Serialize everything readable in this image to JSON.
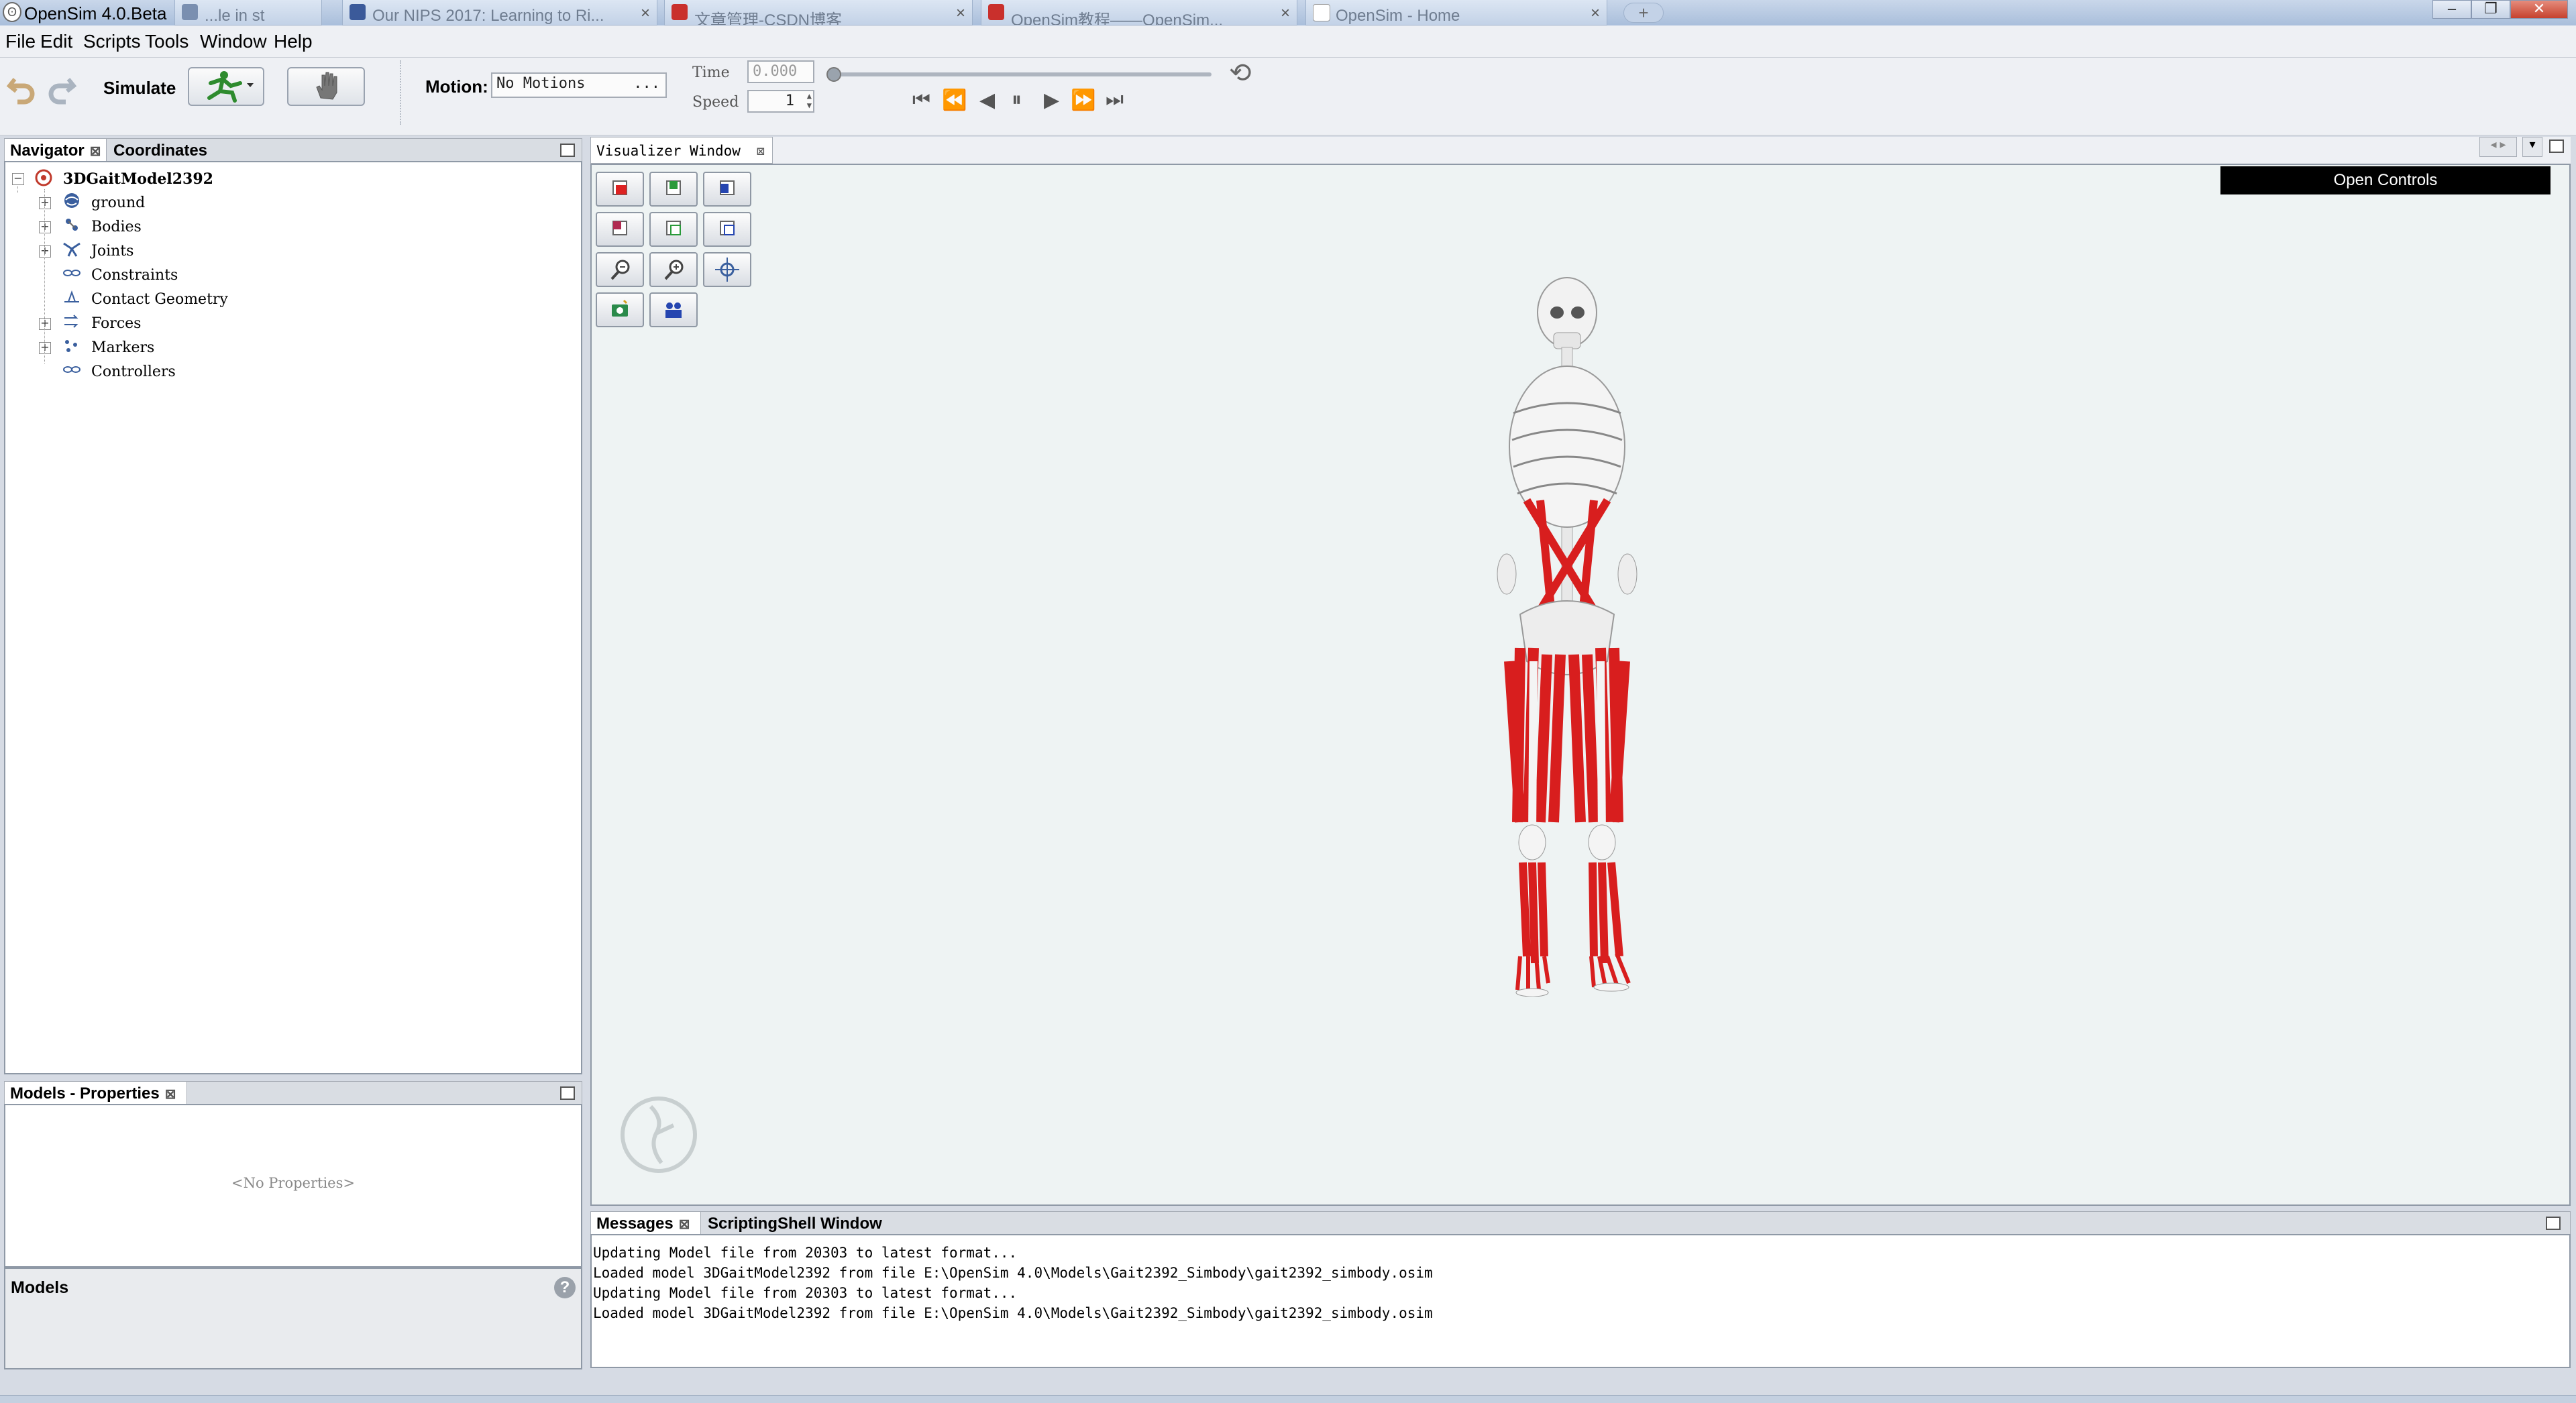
{
  "app": {
    "title": "OpenSim 4.0.Beta",
    "logo_glyph": "ʘ"
  },
  "background_tabs": [
    {
      "label": "...le in st",
      "color": "#7a8fb0"
    },
    {
      "label": "Our NIPS 2017: Learning to Ri...",
      "color": "#3b5a9a"
    },
    {
      "label": "文章管理-CSDN博客",
      "color": "#c9302c"
    },
    {
      "label": "OpenSim教程——OpenSim...",
      "color": "#c9302c"
    },
    {
      "label": "OpenSim - Home",
      "color": "#ffffff"
    }
  ],
  "window_buttons": {
    "minimize": "–",
    "restore": "❐",
    "close": "✕"
  },
  "menu": [
    "File",
    "Edit",
    "Scripts",
    "Tools",
    "Window",
    "Help"
  ],
  "toolbar": {
    "simulate_label": "Simulate",
    "motion_label": "Motion:",
    "motion_value": "No Motions",
    "motion_more": "...",
    "time_label": "Time",
    "time_value": "0.000",
    "speed_label": "Speed",
    "speed_value": "1",
    "loop_icon": "⟲"
  },
  "navigator": {
    "tabs": [
      {
        "label": "Navigator",
        "close": "⊠"
      },
      {
        "label": "Coordinates"
      }
    ],
    "root": "3DGaitModel2392",
    "items": [
      {
        "label": "ground",
        "expandable": true,
        "icon": "ground-icon"
      },
      {
        "label": "Bodies",
        "expandable": true,
        "icon": "bodies-icon"
      },
      {
        "label": "Joints",
        "expandable": true,
        "icon": "joints-icon"
      },
      {
        "label": "Constraints",
        "expandable": false,
        "icon": "constraints-icon"
      },
      {
        "label": "Contact Geometry",
        "expandable": false,
        "icon": "contact-geometry-icon"
      },
      {
        "label": "Forces",
        "expandable": true,
        "icon": "forces-icon"
      },
      {
        "label": "Markers",
        "expandable": true,
        "icon": "markers-icon"
      },
      {
        "label": "Controllers",
        "expandable": false,
        "icon": "controllers-icon"
      }
    ],
    "expand_glyph": "+",
    "collapse_glyph": "−"
  },
  "properties": {
    "tab_label": "Models - Properties",
    "tab_close": "⊠",
    "empty_text": "<No Properties>",
    "footer_title": "Models",
    "help_glyph": "?"
  },
  "visualizer": {
    "tab_label": "Visualizer Window",
    "tab_close": "⊠",
    "open_controls": "Open Controls",
    "buttons": [
      "front-view-icon",
      "side-view-icon",
      "back-view-icon",
      "top-view-icon",
      "bottom-view-icon",
      "iso-view-icon",
      "zoom-out-icon",
      "zoom-in-icon",
      "fit-view-icon",
      "snapshot-icon",
      "record-movie-icon"
    ],
    "colors": {
      "background": "#eef3f3",
      "muscle": "#d81e1e",
      "bone": "#f2f2f2"
    }
  },
  "messages": {
    "tabs": [
      {
        "label": "Messages",
        "close": "⊠"
      },
      {
        "label": "ScriptingShell Window"
      }
    ],
    "lines": [
      "Updating Model file from 20303 to latest format...",
      "Loaded model 3DGaitModel2392 from file E:\\OpenSim 4.0\\Models\\Gait2392_Simbody\\gait2392_simbody.osim",
      "Updating Model file from 20303 to latest format...",
      "Loaded model 3DGaitModel2392 from file E:\\OpenSim 4.0\\Models\\Gait2392_Simbody\\gait2392_simbody.osim"
    ]
  }
}
